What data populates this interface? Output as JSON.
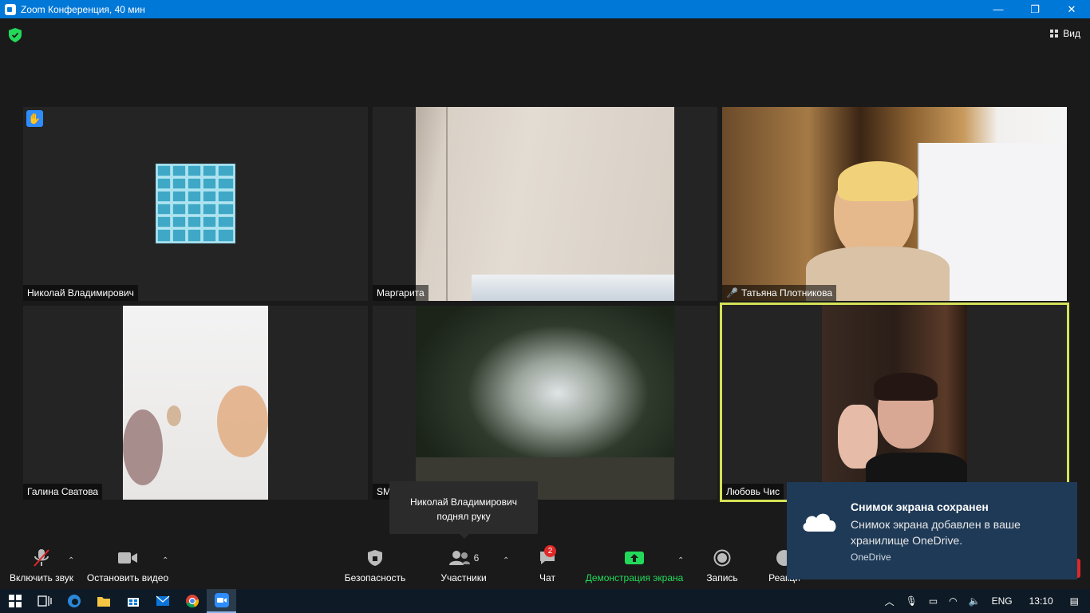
{
  "window": {
    "title": "Zoom Конференция, 40 мин",
    "minimize": "—",
    "restore": "❐",
    "close": "✕"
  },
  "header": {
    "view_label": "Вид"
  },
  "participants_tiles": [
    {
      "name": "Николай Владимирович",
      "hand_raised": true,
      "muted": false
    },
    {
      "name": "Маргарита",
      "muted": false
    },
    {
      "name": "Татьяна Плотникова",
      "muted": true
    },
    {
      "name": "Галина Сватова",
      "muted": false
    },
    {
      "name": "SM",
      "muted": false
    },
    {
      "name": "Любовь Чис",
      "active_speaker": true,
      "muted": false
    }
  ],
  "tooltip": {
    "line1": "Николай Владимирович",
    "line2": "поднял руку"
  },
  "toolbar": {
    "audio_label": "Включить звук",
    "video_label": "Остановить видео",
    "security_label": "Безопасность",
    "participants_label": "Участники",
    "participants_count": "6",
    "chat_label": "Чат",
    "chat_badge": "2",
    "share_label": "Демонстрация экрана",
    "record_label": "Запись",
    "reactions_label": "Реакци"
  },
  "toast": {
    "title": "Снимок экрана сохранен",
    "body": "Снимок экрана добавлен в ваше хранилище OneDrive.",
    "source": "OneDrive"
  },
  "taskbar": {
    "language": "ENG",
    "time": "13:10"
  },
  "colors": {
    "accent": "#2d8cff",
    "share_green": "#23d959",
    "active_speaker_border": "#d4e157",
    "mute_red": "#e02828",
    "titlebar": "#0078d7",
    "toast_bg": "#1f3a57"
  }
}
